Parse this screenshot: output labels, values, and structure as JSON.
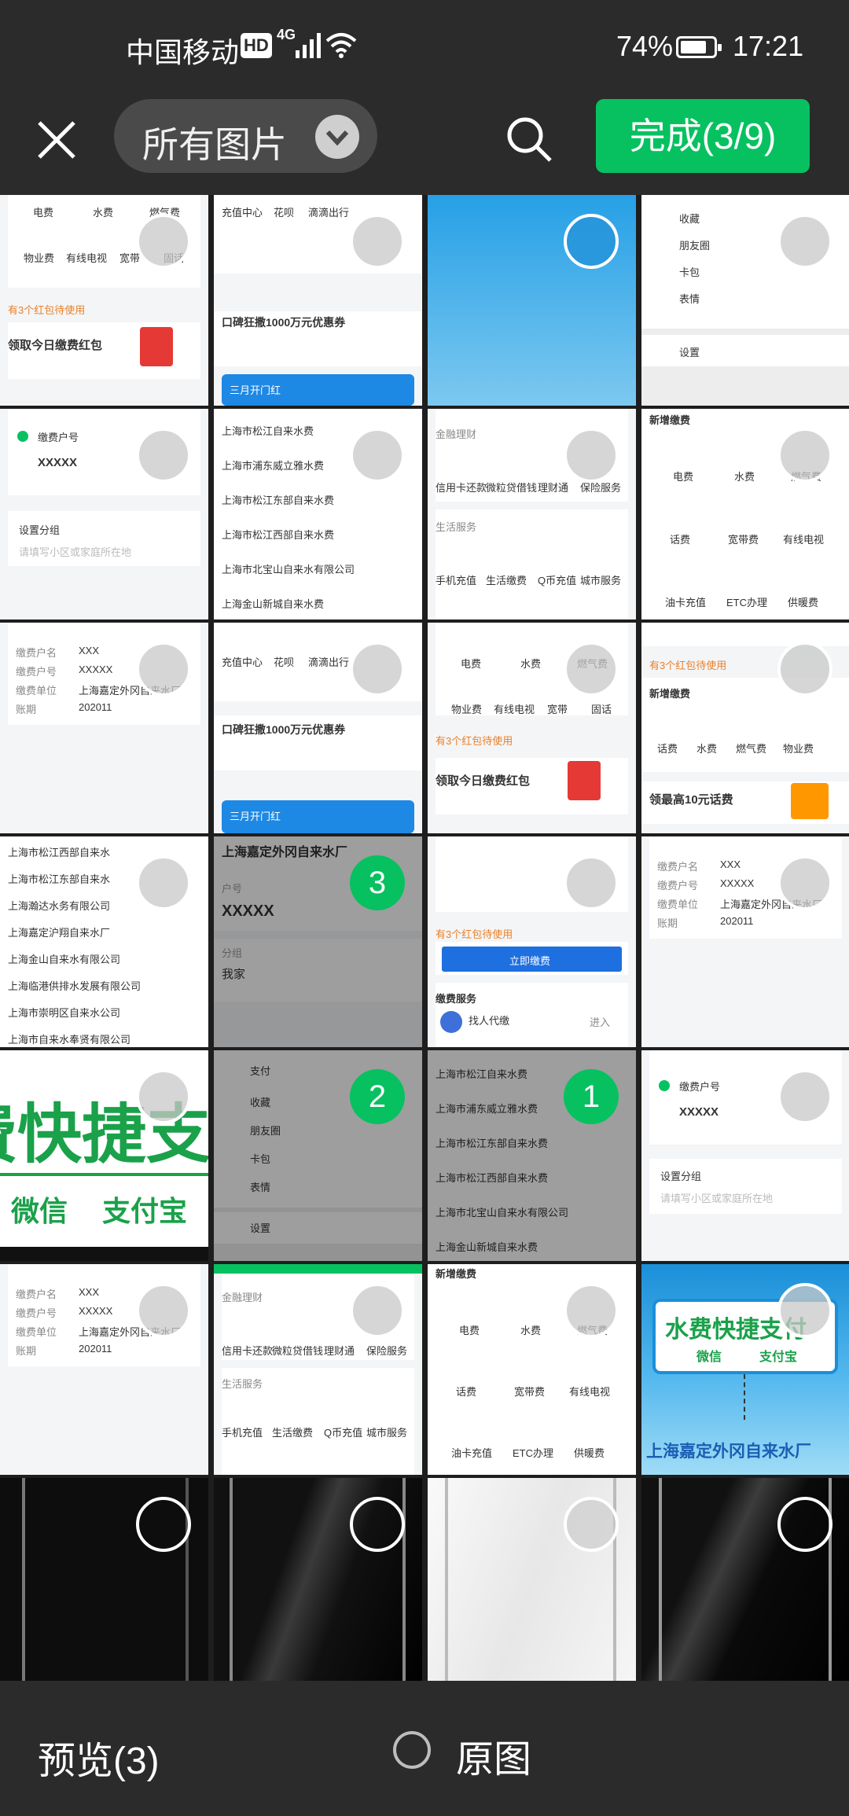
{
  "status": {
    "carrier": "中国移动",
    "hd": "HD",
    "network": "4G",
    "battery": "74%",
    "time": "17:21"
  },
  "header": {
    "album_name": "所有图片",
    "done_label": "完成(3/9)"
  },
  "footer": {
    "preview_label": "预览(3)",
    "original_label": "原图"
  },
  "colors": {
    "accent": "#07c160",
    "bar_bg": "#2b2b2b"
  },
  "thumb_text": {
    "t01": "电费",
    "t02": "水费",
    "t03": "燃气费",
    "t04": "物业费",
    "t05": "有线电视",
    "t06": "宽带",
    "t07": "固话",
    "t08": "有3个红包待使用",
    "t09": "领取今日缴费红包",
    "t10": "充值中心",
    "t11": "花呗",
    "t12": "滴滴出行",
    "t13": "口碑狂撒1000万元优惠券",
    "t14": "三月开门红",
    "t15": "收藏",
    "t16": "朋友圈",
    "t17": "卡包",
    "t18": "表情",
    "t19": "设置",
    "t20": "缴费户号",
    "t21": "XXXXX",
    "t22": "设置分组",
    "t23": "请填写小区或家庭所在地",
    "w1": "上海市松江自来水费",
    "w2": "上海市浦东威立雅水费",
    "w3": "上海市松江东部自来水费",
    "w4": "上海市松江西部自来水费",
    "w5": "上海市北宝山自来水有限公司",
    "w6": "上海金山新城自来水费",
    "t30": "金融理财",
    "t31": "信用卡还款",
    "t32": "微粒贷借钱",
    "t33": "理财通",
    "t34": "保险服务",
    "t35": "生活服务",
    "t36": "手机充值",
    "t37": "生活缴费",
    "t38": "Q币充值",
    "t39": "城市服务",
    "t40": "新增缴费",
    "t41": "话费",
    "t42": "宽带费",
    "t43": "油卡充值",
    "t44": "ETC办理",
    "t45": "供暖费",
    "t50": "缴费户名",
    "t51": "XXX",
    "t52": "缴费户号",
    "t53": "缴费单位",
    "t54": "上海嘉定外冈自来水厂",
    "t55": "账期",
    "t56": "202011",
    "t57": "领最高10元话费",
    "c1": "上海市松江西部自来水",
    "c2": "上海市松江东部自来水",
    "c3": "上海瀚达水务有限公司",
    "c4": "上海嘉定沪翔自来水厂",
    "c5": "上海金山自来水有限公司",
    "c6": "上海临港供排水发展有限公司",
    "c7": "上海市崇明区自来水公司",
    "c8": "上海市自来水奉贤有限公司",
    "t60": "上海嘉定外冈自来水厂",
    "t61": "户号",
    "t62": "分组",
    "t63": "我家",
    "t64": "立即缴费",
    "t65": "缴费服务",
    "t66": "找人代缴",
    "t67": "进入",
    "t70": "费快捷支",
    "t71": "微信",
    "t72": "支付宝",
    "t73": "支付",
    "t74": "水费快捷支付",
    "t75": "上海嘉定外冈自来水厂"
  },
  "selections": {
    "s1": "3",
    "s2": "2",
    "s3": "1"
  }
}
